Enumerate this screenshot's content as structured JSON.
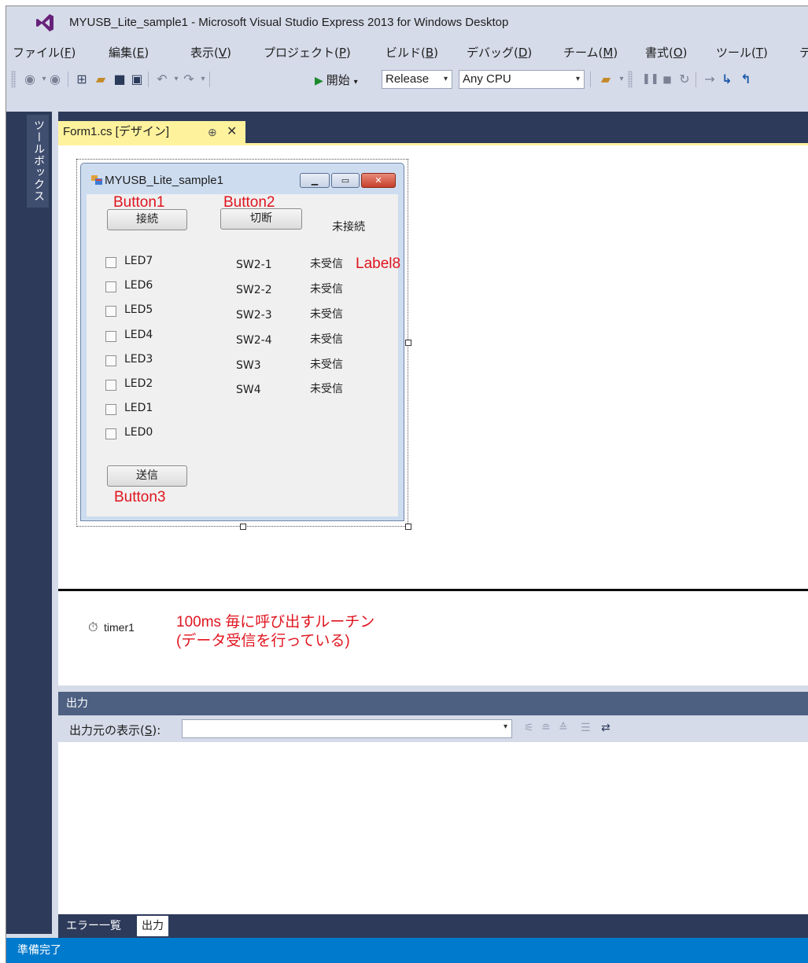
{
  "window": {
    "title": "MYUSB_Lite_sample1 - Microsoft Visual Studio Express 2013 for Windows Desktop"
  },
  "menu": [
    {
      "label": "ファイル(",
      "key": "F",
      "suffix": ")"
    },
    {
      "label": "編集(",
      "key": "E",
      "suffix": ")"
    },
    {
      "label": "表示(",
      "key": "V",
      "suffix": ")"
    },
    {
      "label": "プロジェクト(",
      "key": "P",
      "suffix": ")"
    },
    {
      "label": "ビルド(",
      "key": "B",
      "suffix": ")"
    },
    {
      "label": "デバッグ(",
      "key": "D",
      "suffix": ")"
    },
    {
      "label": "チーム(",
      "key": "M",
      "suffix": ")"
    },
    {
      "label": "書式(",
      "key": "O",
      "suffix": ")"
    },
    {
      "label": "ツール(",
      "key": "T",
      "suffix": ")"
    },
    {
      "label": "テ",
      "key": "",
      "suffix": ""
    }
  ],
  "toolbar": {
    "start_label": "開始",
    "config_value": "Release",
    "platform_value": "Any CPU"
  },
  "toolbox": {
    "label": "ツールボックス"
  },
  "document_tab": {
    "label": "Form1.cs [デザイン]",
    "pin": "⊕",
    "close": "✕"
  },
  "form": {
    "title": "MYUSB_Lite_sample1",
    "button1": "接続",
    "button2": "切断",
    "status_label": "未接続",
    "checkboxes": [
      "LED7",
      "LED6",
      "LED5",
      "LED4",
      "LED3",
      "LED2",
      "LED1",
      "LED0"
    ],
    "switches": [
      {
        "name": "SW2-1",
        "value": "未受信"
      },
      {
        "name": "SW2-2",
        "value": "未受信"
      },
      {
        "name": "SW2-3",
        "value": "未受信"
      },
      {
        "name": "SW2-4",
        "value": "未受信"
      },
      {
        "name": "SW3",
        "value": "未受信"
      },
      {
        "name": "SW4",
        "value": "未受信"
      }
    ],
    "button3": "送信"
  },
  "annotations": {
    "button1": "Button1",
    "button2": "Button2",
    "button3": "Button3",
    "label8": "Label8",
    "timer_line1": "100ms 毎に呼び出すルーチン",
    "timer_line2": "(データ受信を行っている)"
  },
  "component_tray": {
    "timer_label": "timer1"
  },
  "output": {
    "header": "出力",
    "source_label": "出力元の表示(",
    "source_key": "S",
    "source_suffix": "):",
    "source_value": ""
  },
  "bottom_tabs": {
    "errors": "エラー一覧",
    "output": "出力"
  },
  "status": {
    "text": "準備完了"
  },
  "colors": {
    "accent": "#007acc",
    "annotation": "#e0141e",
    "doc_tab": "#fff29d",
    "chrome": "#d6dbe9",
    "dark_panel": "#2d3a5a"
  }
}
